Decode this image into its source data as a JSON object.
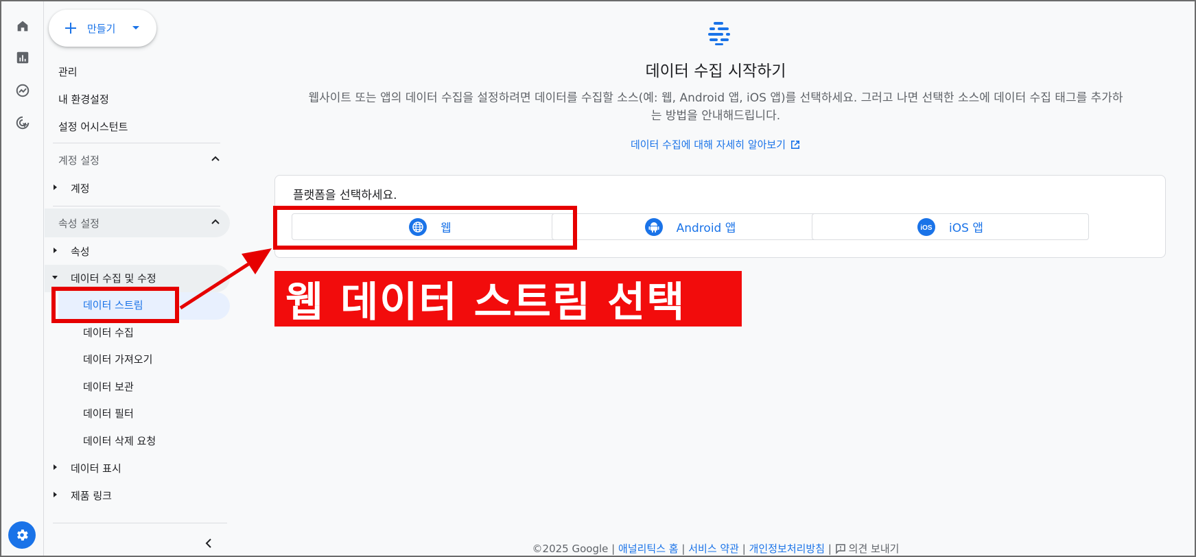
{
  "create_button": {
    "label": "만들기"
  },
  "sidebar": {
    "top_items": [
      "관리",
      "내 환경설정",
      "설정 어시스턴트"
    ],
    "account_section": {
      "title": "계정 설정",
      "items": [
        "계정"
      ]
    },
    "property_section": {
      "title": "속성 설정",
      "items": [
        "속성",
        "데이터 수집 및 수정"
      ],
      "sub_items": [
        "데이터 스트림",
        "데이터 수집",
        "데이터 가져오기",
        "데이터 보관",
        "데이터 필터",
        "데이터 삭제 요청"
      ],
      "after_items": [
        "데이터 표시",
        "제품 링크"
      ]
    }
  },
  "main": {
    "title": "데이터 수집 시작하기",
    "description": "웹사이트 또는 앱의 데이터 수집을 설정하려면 데이터를 수집할 소스(예: 웹, Android 앱, iOS 앱)를 선택하세요. 그러고 나면 선택한 소스에 데이터 수집 태그를 추가하는 방법을 안내해드립니다.",
    "learn_more": "데이터 수집에 대해 자세히 알아보기",
    "platform_prompt": "플랫폼을 선택하세요.",
    "platforms": [
      {
        "label": "웹",
        "icon": "globe-icon"
      },
      {
        "label": "Android 앱",
        "icon": "android-icon"
      },
      {
        "label": "iOS 앱",
        "icon": "ios-icon"
      }
    ]
  },
  "footer": {
    "copyright": "©2025 Google",
    "links": [
      "애널리틱스 홈",
      "서비스 약관",
      "개인정보처리방침"
    ],
    "feedback": "의견 보내기",
    "separator": "|"
  },
  "annotation": {
    "callout_text": "웹 데이터 스트림 선택",
    "color": "#e60000"
  },
  "colors": {
    "accent": "#1a73e8",
    "annotation_red": "#e60000"
  }
}
